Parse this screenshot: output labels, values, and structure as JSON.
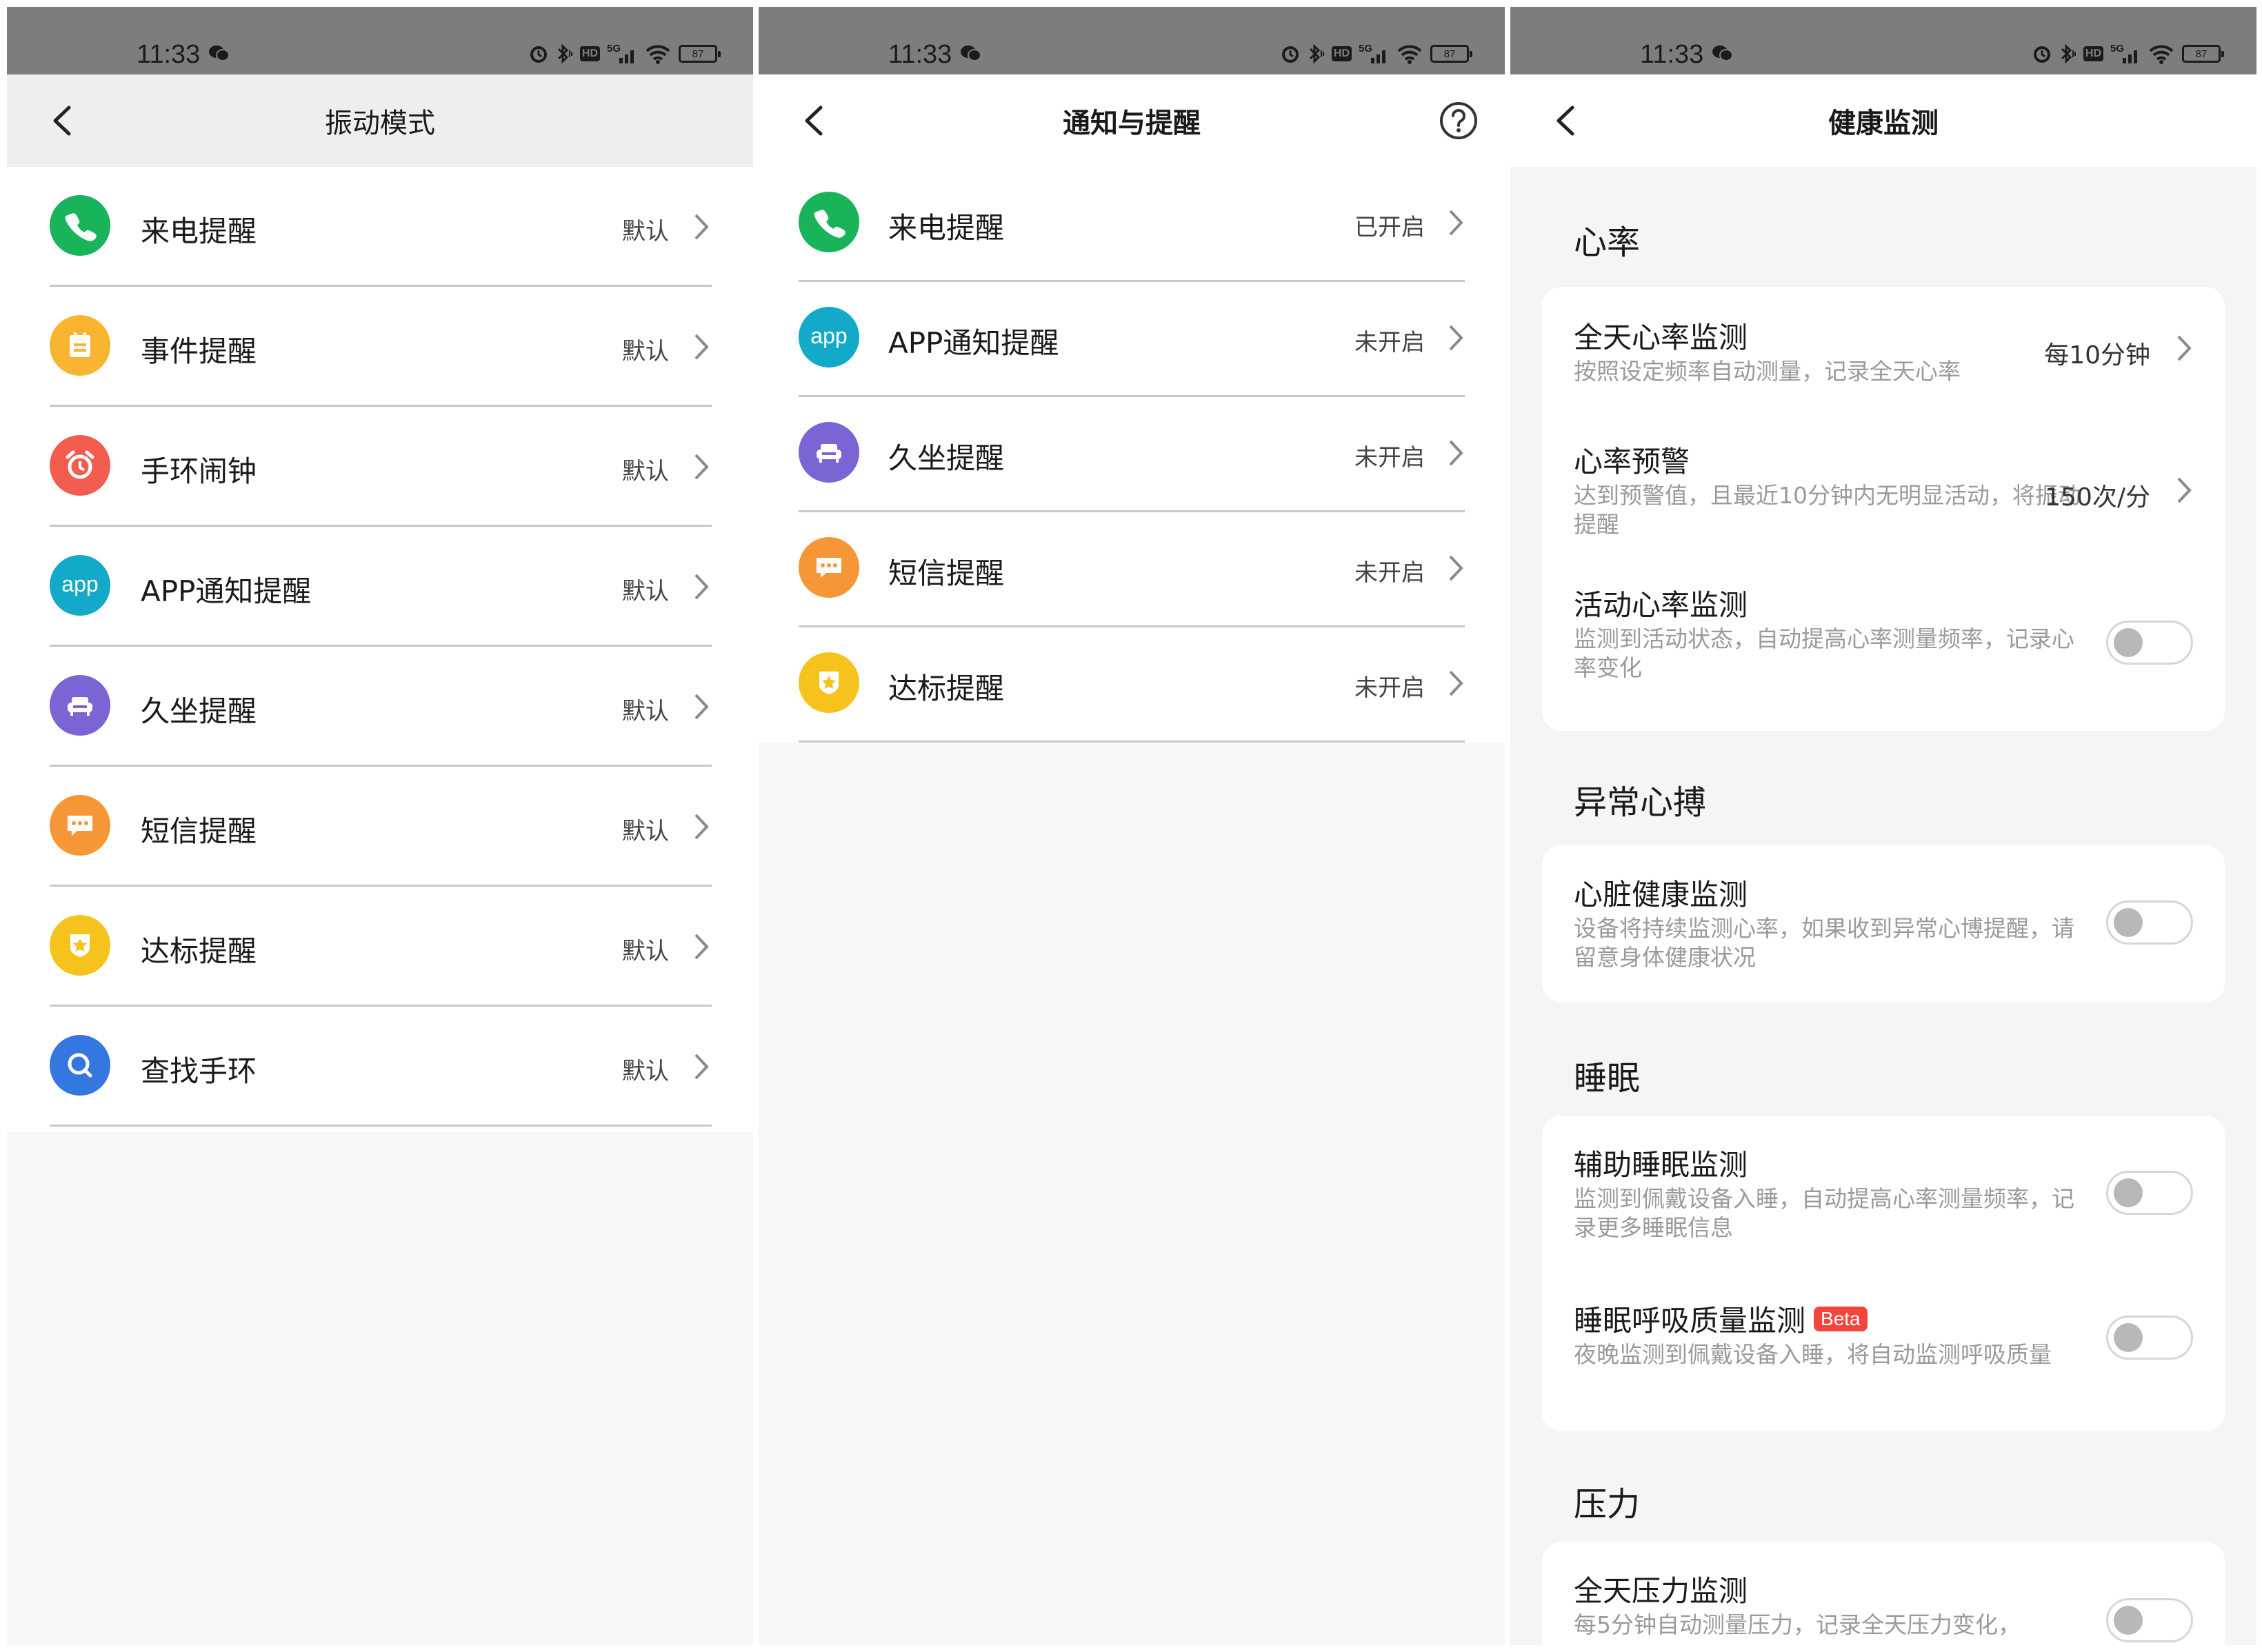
{
  "status_bar": {
    "time": "11:33",
    "hd": "HD",
    "network": "5G",
    "battery": "87"
  },
  "screen1": {
    "title": "振动模式",
    "rows": [
      {
        "label": "来电提醒",
        "value": "默认",
        "icon": "phone-icon",
        "color": "#19b35a"
      },
      {
        "label": "事件提醒",
        "value": "默认",
        "icon": "calendar-icon",
        "color": "#f9b531"
      },
      {
        "label": "手环闹钟",
        "value": "默认",
        "icon": "alarm-clock-icon",
        "color": "#f25d4f"
      },
      {
        "label": "APP通知提醒",
        "value": "默认",
        "icon": "app-icon",
        "color": "#13a9c9"
      },
      {
        "label": "久坐提醒",
        "value": "默认",
        "icon": "sofa-icon",
        "color": "#7b64d3"
      },
      {
        "label": "短信提醒",
        "value": "默认",
        "icon": "message-icon",
        "color": "#f79637"
      },
      {
        "label": "达标提醒",
        "value": "默认",
        "icon": "badge-star-icon",
        "color": "#f6c21c"
      },
      {
        "label": "查找手环",
        "value": "默认",
        "icon": "search-icon",
        "color": "#3577e1"
      }
    ]
  },
  "screen2": {
    "title": "通知与提醒",
    "rows": [
      {
        "label": "来电提醒",
        "value": "已开启",
        "icon": "phone-icon",
        "color": "#19b35a"
      },
      {
        "label": "APP通知提醒",
        "value": "未开启",
        "icon": "app-icon",
        "color": "#13a9c9"
      },
      {
        "label": "久坐提醒",
        "value": "未开启",
        "icon": "sofa-icon",
        "color": "#7b64d3"
      },
      {
        "label": "短信提醒",
        "value": "未开启",
        "icon": "message-icon",
        "color": "#f79637"
      },
      {
        "label": "达标提醒",
        "value": "未开启",
        "icon": "badge-star-icon",
        "color": "#f6c21c"
      }
    ]
  },
  "screen3": {
    "title": "健康监测",
    "sections": [
      {
        "title": "心率",
        "items": [
          {
            "title": "全天心率监测",
            "subtitle": "按照设定频率自动测量，记录全天心率",
            "value": "每10分钟",
            "control": "chevron"
          },
          {
            "title": "心率预警",
            "subtitle": "达到预警值，且最近10分钟内无明显活动，将振动提醒",
            "value": "150次/分",
            "control": "chevron"
          },
          {
            "title": "活动心率监测",
            "subtitle": "监测到活动状态，自动提高心率测量频率，记录心率变化",
            "control": "toggle",
            "on": false
          }
        ]
      },
      {
        "title": "异常心搏",
        "items": [
          {
            "title": "心脏健康监测",
            "subtitle": "设备将持续监测心率，如果收到异常心博提醒，请留意身体健康状况",
            "control": "toggle",
            "on": false
          }
        ]
      },
      {
        "title": "睡眠",
        "items": [
          {
            "title": "辅助睡眠监测",
            "subtitle": "监测到佩戴设备入睡，自动提高心率测量频率，记录更多睡眠信息",
            "control": "toggle",
            "on": false
          },
          {
            "title": "睡眠呼吸质量监测",
            "badge": "Beta",
            "subtitle": "夜晚监测到佩戴设备入睡，将自动监测呼吸质量",
            "control": "toggle",
            "on": false
          }
        ]
      },
      {
        "title": "压力",
        "items": [
          {
            "title": "全天压力监测",
            "subtitle": "每5分钟自动测量压力，记录全天压力变化，",
            "control": "toggle",
            "on": false
          }
        ]
      }
    ]
  },
  "colors": {
    "status_bar": "#7d7d7d",
    "nav_gray": "#eeeeee",
    "divider": "#c8c8c8",
    "badge": "#f4453c",
    "subtitle": "#9a9a9a"
  }
}
